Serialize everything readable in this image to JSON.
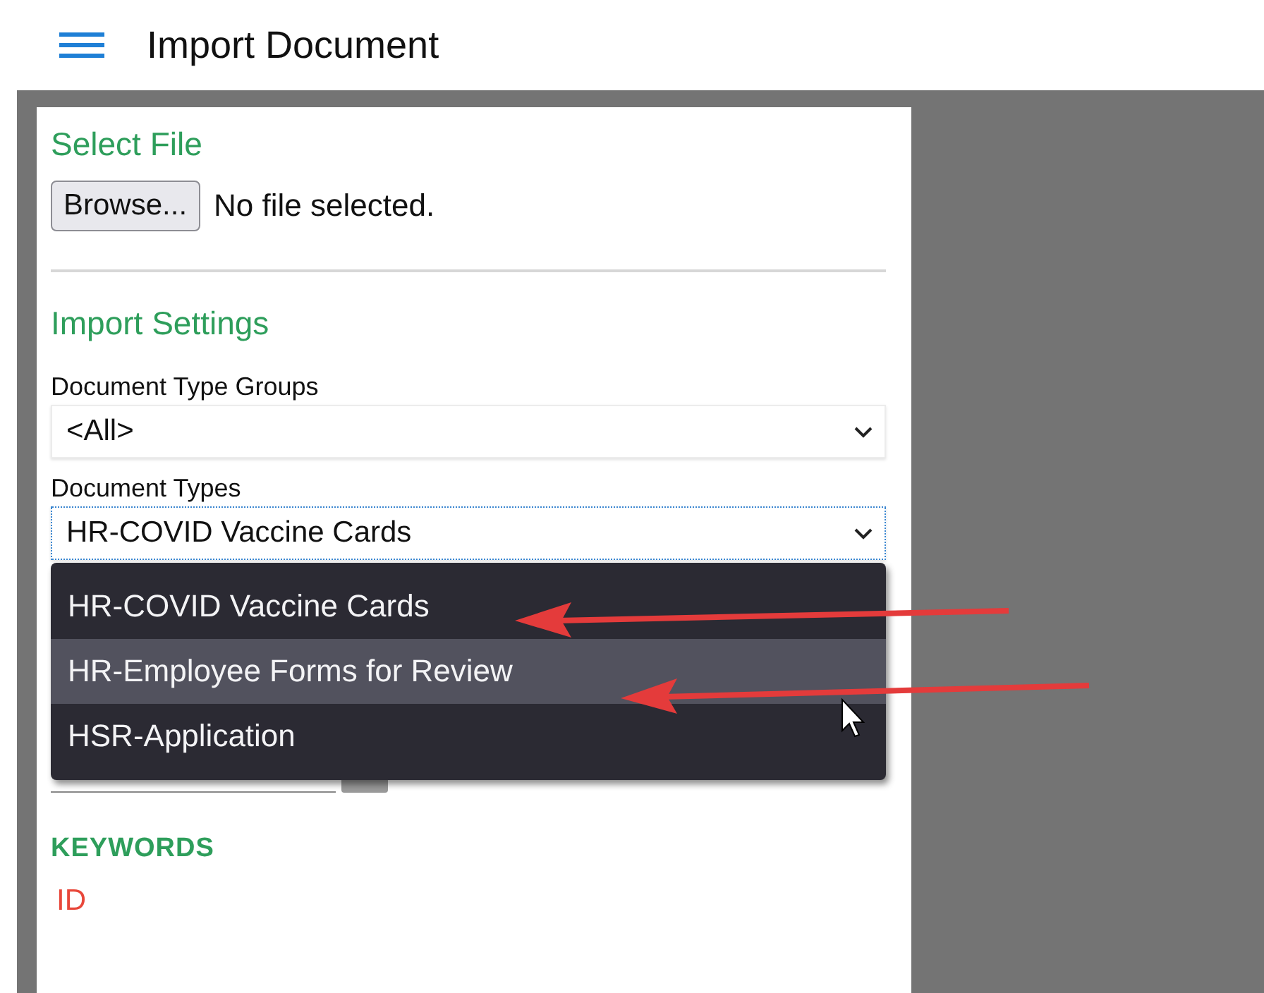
{
  "header": {
    "title": "Import Document"
  },
  "select_file": {
    "heading": "Select File",
    "browse_button": "Browse...",
    "status": "No file selected."
  },
  "import_settings": {
    "heading": "Import Settings",
    "fields": [
      {
        "label": "Document Type Groups",
        "value": "<All>",
        "focused": false
      },
      {
        "label": "Document Types",
        "value": "HR-COVID Vaccine Cards",
        "focused": true
      }
    ]
  },
  "dropdown_menu": {
    "options": [
      {
        "label": "HR-COVID Vaccine Cards",
        "highlighted": false
      },
      {
        "label": "HR-Employee Forms for Review",
        "highlighted": true
      },
      {
        "label": "HSR-Application",
        "highlighted": false
      }
    ]
  },
  "keywords": {
    "heading": "KEYWORDS",
    "items": [
      "ID"
    ]
  }
}
